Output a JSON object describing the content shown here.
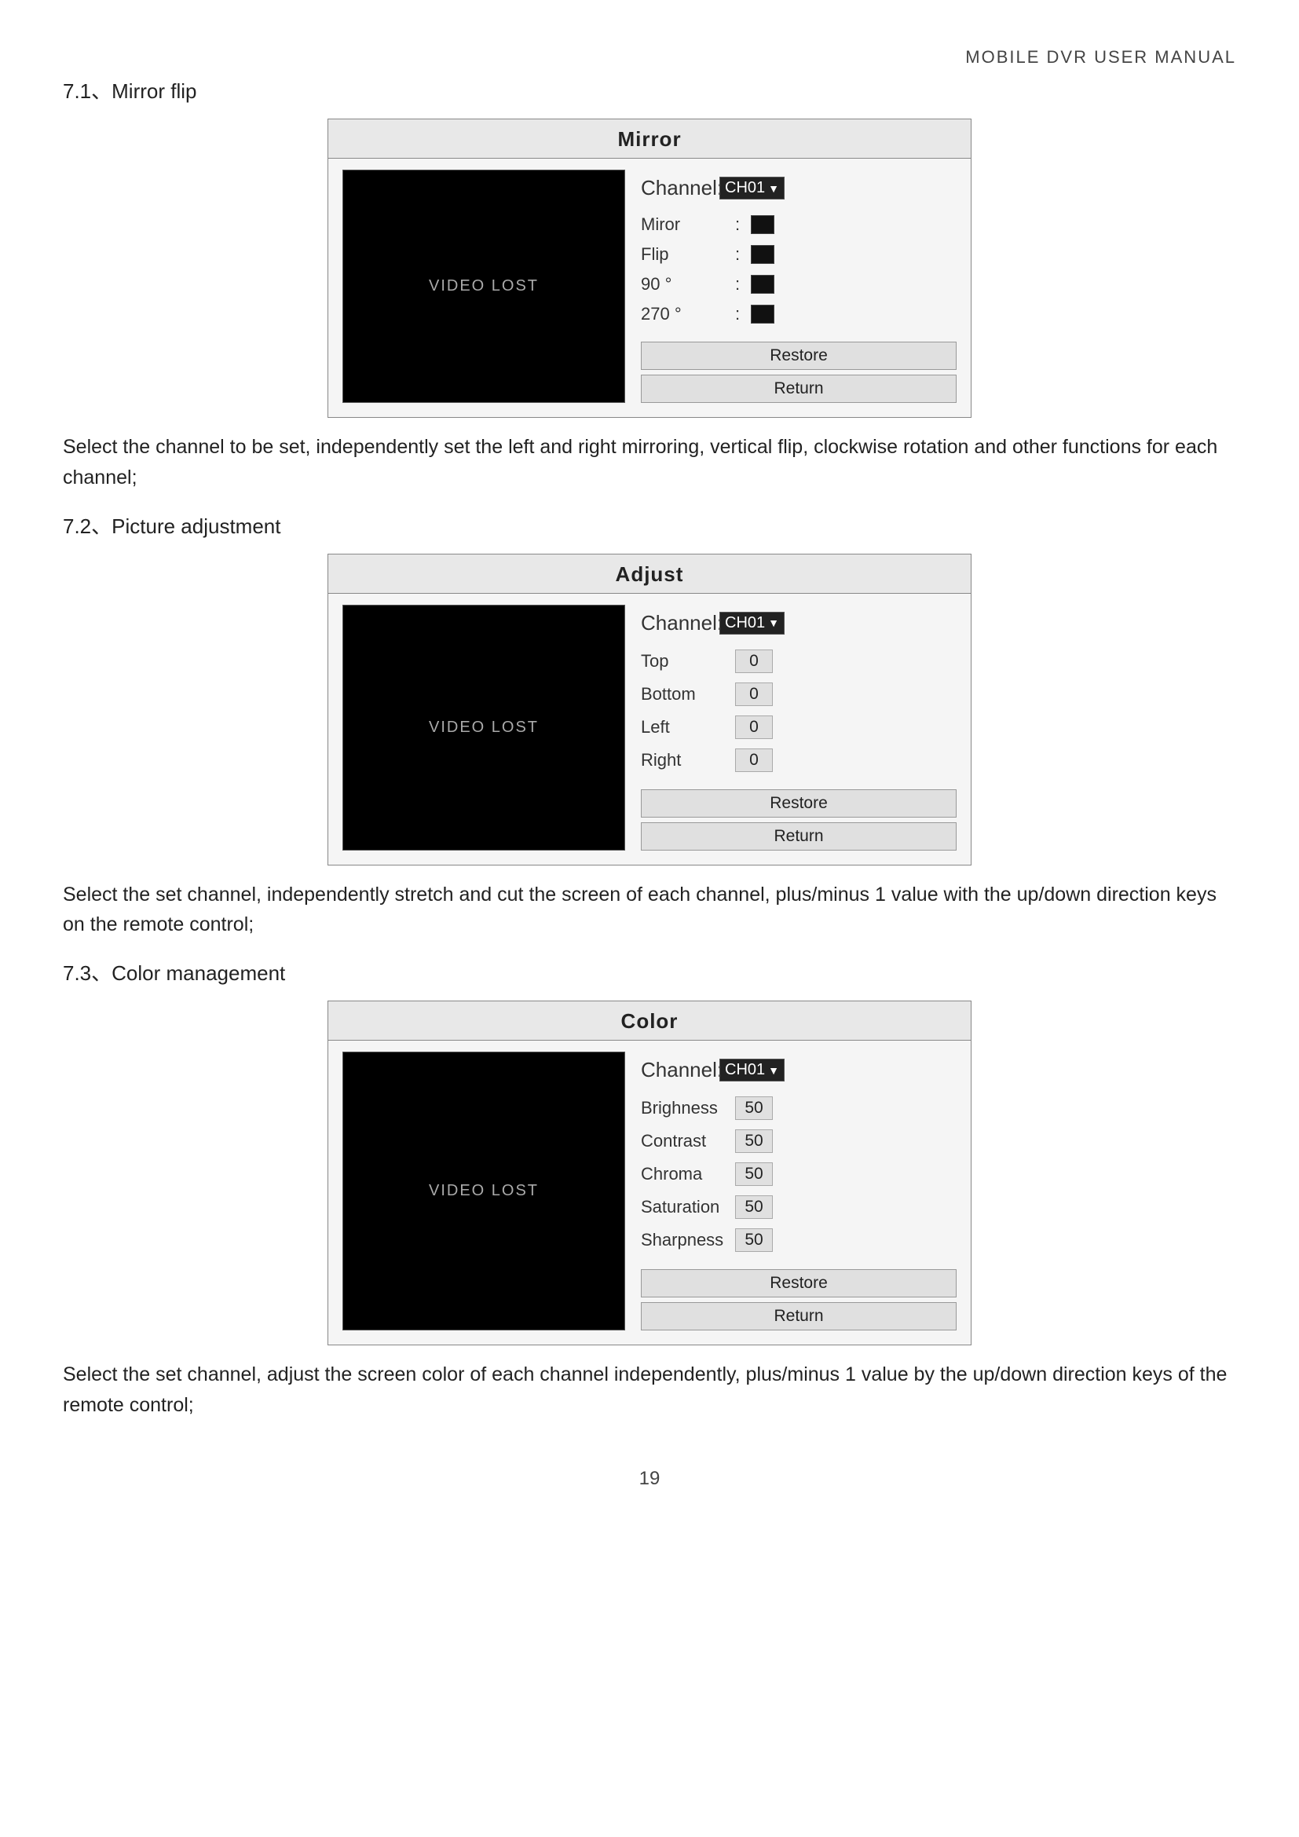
{
  "header": {
    "title": "MOBILE  DVR  USER  MANUAL"
  },
  "page_number": "19",
  "sections": [
    {
      "id": "mirror",
      "heading": "7.1、Mirror flip",
      "dialog_title": "Mirror",
      "video_lost": "VIDEO LOST",
      "channel_label": "Channel:",
      "channel_value": "CH01",
      "controls": [
        {
          "label": "Miror",
          "colon": ":",
          "type": "black_square"
        },
        {
          "label": "Flip",
          "colon": ":",
          "type": "black_square"
        },
        {
          "label": "90 °",
          "colon": ":",
          "type": "black_square"
        },
        {
          "label": "270 °",
          "colon": ":",
          "type": "black_square"
        }
      ],
      "buttons": [
        "Restore",
        "Return"
      ],
      "paragraph": "Select the channel to be set, independently set the left and right mirroring, vertical flip, clockwise rotation and other functions for each channel;"
    },
    {
      "id": "adjust",
      "heading": "7.2、Picture adjustment",
      "dialog_title": "Adjust",
      "video_lost": "VIDEO LOST",
      "channel_label": "Channel:",
      "channel_value": "CH01",
      "controls": [
        {
          "label": "Top",
          "type": "value",
          "value": "0"
        },
        {
          "label": "Bottom",
          "type": "value",
          "value": "0"
        },
        {
          "label": "Left",
          "type": "value",
          "value": "0"
        },
        {
          "label": "Right",
          "type": "value",
          "value": "0"
        }
      ],
      "buttons": [
        "Restore",
        "Return"
      ],
      "paragraph": "Select the set channel, independently stretch and cut the screen of each channel, plus/minus 1 value with the up/down direction keys on the remote control;"
    },
    {
      "id": "color",
      "heading": "7.3、Color management",
      "dialog_title": "Color",
      "video_lost": "VIDEO LOST",
      "channel_label": "Channel:",
      "channel_value": "CH01",
      "controls": [
        {
          "label": "Brighness",
          "type": "value",
          "value": "50"
        },
        {
          "label": "Contrast",
          "type": "value",
          "value": "50"
        },
        {
          "label": "Chroma",
          "type": "value",
          "value": "50"
        },
        {
          "label": "Saturation",
          "type": "value",
          "value": "50"
        },
        {
          "label": "Sharpness",
          "type": "value",
          "value": "50"
        }
      ],
      "buttons": [
        "Restore",
        "Return"
      ],
      "paragraph": "Select the set channel, adjust the screen color of each channel independently, plus/minus 1 value by the up/down direction keys of the remote control;"
    }
  ]
}
